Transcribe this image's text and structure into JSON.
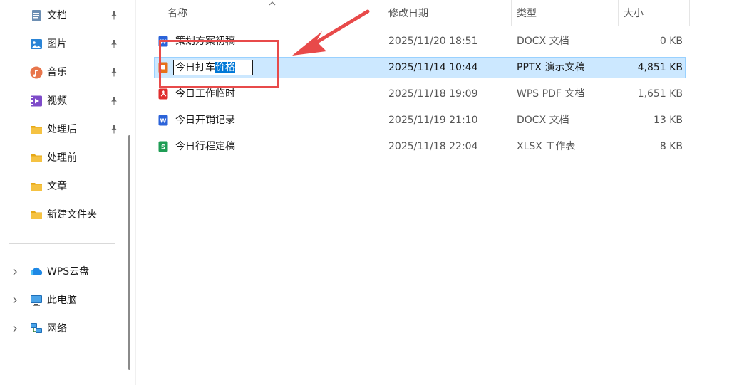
{
  "sidebar": {
    "quick_access": [
      {
        "label": "文档",
        "icon": "document-icon",
        "pinned": true
      },
      {
        "label": "图片",
        "icon": "picture-icon",
        "pinned": true
      },
      {
        "label": "音乐",
        "icon": "music-icon",
        "pinned": true
      },
      {
        "label": "视频",
        "icon": "video-icon",
        "pinned": true
      },
      {
        "label": "处理后",
        "icon": "folder-icon",
        "pinned": true
      },
      {
        "label": "处理前",
        "icon": "folder-icon",
        "pinned": false
      },
      {
        "label": "文章",
        "icon": "folder-icon",
        "pinned": false
      },
      {
        "label": "新建文件夹",
        "icon": "folder-icon",
        "pinned": false
      }
    ],
    "locations": [
      {
        "label": "WPS云盘",
        "icon": "cloud-icon"
      },
      {
        "label": "此电脑",
        "icon": "computer-icon"
      },
      {
        "label": "网络",
        "icon": "network-icon"
      }
    ]
  },
  "columns": {
    "name": "名称",
    "modified": "修改日期",
    "type": "类型",
    "size": "大小"
  },
  "files": [
    {
      "name": "策划方案初稿",
      "modified": "2025/11/20 18:51",
      "type": "DOCX 文档",
      "size": "0 KB",
      "icon": "docx-icon"
    },
    {
      "name": "今日打车价格",
      "name_plain": "今日打车",
      "name_selected": "价格",
      "modified": "2025/11/14 10:44",
      "type": "PPTX 演示文稿",
      "size": "4,851 KB",
      "icon": "pptx-icon",
      "selected": true,
      "renaming": true
    },
    {
      "name": "今日工作临时",
      "modified": "2025/11/18 19:09",
      "type": "WPS PDF 文档",
      "size": "1,651 KB",
      "icon": "pdf-icon"
    },
    {
      "name": "今日开销记录",
      "modified": "2025/11/19 21:10",
      "type": "DOCX 文档",
      "size": "13 KB",
      "icon": "docx-icon"
    },
    {
      "name": "今日行程定稿",
      "modified": "2025/11/18 22:04",
      "type": "XLSX 工作表",
      "size": "8 KB",
      "icon": "xlsx-icon"
    }
  ],
  "colors": {
    "selection": "#cce8ff",
    "selection_border": "#99d1ff",
    "text_highlight": "#0078d7",
    "annotation": "#e84a4a",
    "docx": "#2b63d9",
    "pptx": "#e8711a",
    "pdf": "#e02d2d",
    "xlsx": "#1f9d55",
    "folder": "#f5c242"
  }
}
